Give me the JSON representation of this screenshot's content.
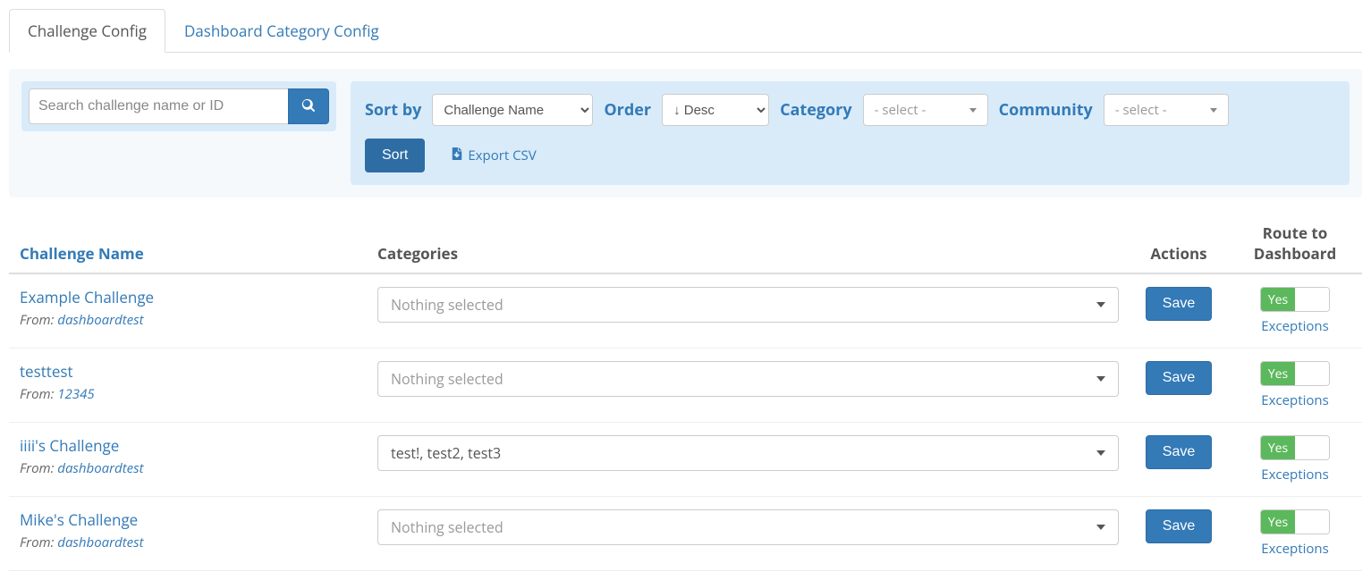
{
  "tabs": [
    {
      "label": "Challenge Config",
      "active": true
    },
    {
      "label": "Dashboard Category Config",
      "active": false
    }
  ],
  "search": {
    "placeholder": "Search challenge name or ID"
  },
  "filters": {
    "sort_by_label": "Sort by",
    "sort_by_value": "Challenge Name",
    "order_label": "Order",
    "order_value": "↓ Desc",
    "category_label": "Category",
    "category_value": "- select -",
    "community_label": "Community",
    "community_value": "- select -",
    "sort_button": "Sort",
    "export_label": "Export CSV"
  },
  "table": {
    "headers": {
      "challenge_name": "Challenge Name",
      "categories": "Categories",
      "actions": "Actions",
      "route": "Route to Dashboard"
    },
    "from_prefix": "From: ",
    "nothing_selected": "Nothing selected",
    "save_label": "Save",
    "toggle_yes": "Yes",
    "exceptions_label": "Exceptions",
    "rows": [
      {
        "name": "Example Challenge",
        "from": "dashboardtest",
        "categories": null
      },
      {
        "name": "testtest",
        "from": "12345",
        "categories": null
      },
      {
        "name": "iiii's Challenge",
        "from": "dashboardtest",
        "categories": "test!, test2, test3"
      },
      {
        "name": "Mike's Challenge",
        "from": "dashboardtest",
        "categories": null
      }
    ]
  }
}
